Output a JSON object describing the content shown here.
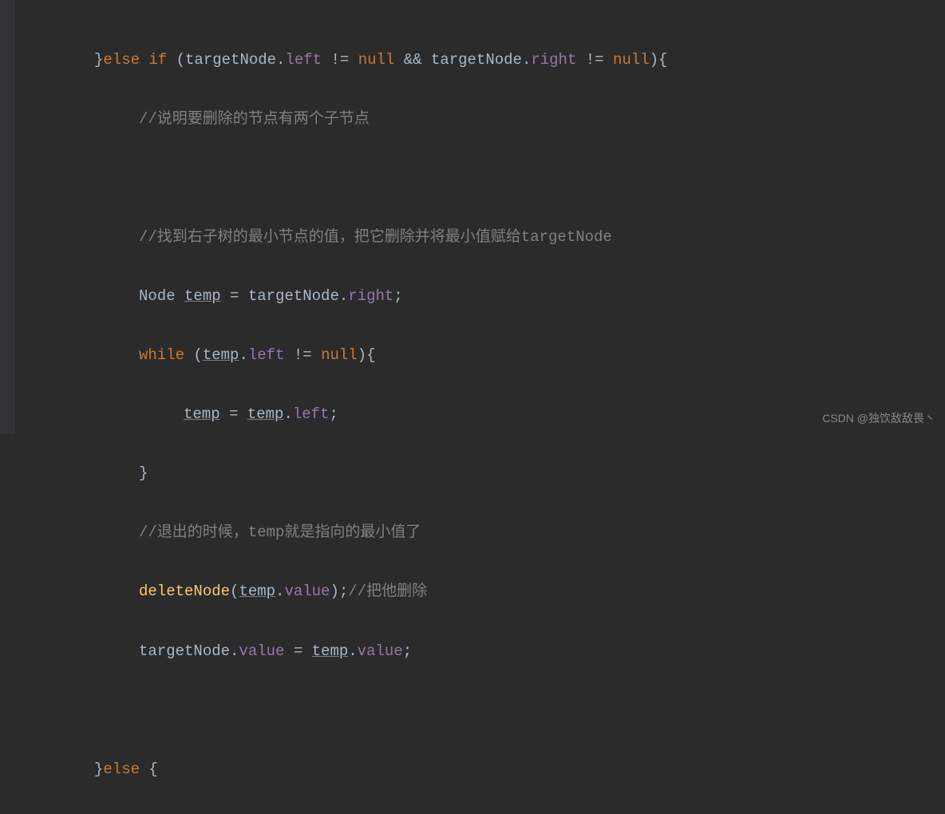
{
  "code": {
    "l1": {
      "brace1": "}",
      "kw1": "else if ",
      "p1": "(",
      "id1": "targetNode",
      "dot1": ".",
      "fld1": "left",
      "op1": " != ",
      "kw2": "null",
      "op2": " && ",
      "id2": "targetNode",
      "dot2": ".",
      "fld2": "right",
      "op3": " != ",
      "kw3": "null",
      "p2": "){"
    },
    "l2": "//说明要删除的节点有两个子节点",
    "l3": "",
    "l4": "//找到右子树的最小节点的值，把它删除并将最小值赋给targetNode",
    "l5": {
      "t1": "Node ",
      "v1": "temp",
      "t2": " = targetNode.",
      "fld": "right",
      "t3": ";"
    },
    "l6": {
      "kw": "while ",
      "p1": "(",
      "v1": "temp",
      "t1": ".",
      "fld": "left",
      "op": " != ",
      "kw2": "null",
      "p2": "){"
    },
    "l7": {
      "v1": "temp",
      "t1": " = ",
      "v2": "temp",
      "t2": ".",
      "fld": "left",
      "t3": ";"
    },
    "l8": "}",
    "l9": "//退出的时候，temp就是指向的最小值了",
    "l10": {
      "m": "deleteNode",
      "p1": "(",
      "v1": "temp",
      "t1": ".",
      "fld": "value",
      "p2": ");",
      "c": "//把他删除"
    },
    "l11": {
      "t1": "targetNode.",
      "fld1": "value",
      "t2": " = ",
      "v1": "temp",
      "t3": ".",
      "fld2": "value",
      "t4": ";"
    },
    "l12": "",
    "l13": {
      "brace": "}",
      "kw": "else ",
      "p": "{"
    }
  },
  "watermark": "CSDN @独饮敌敌畏丶"
}
